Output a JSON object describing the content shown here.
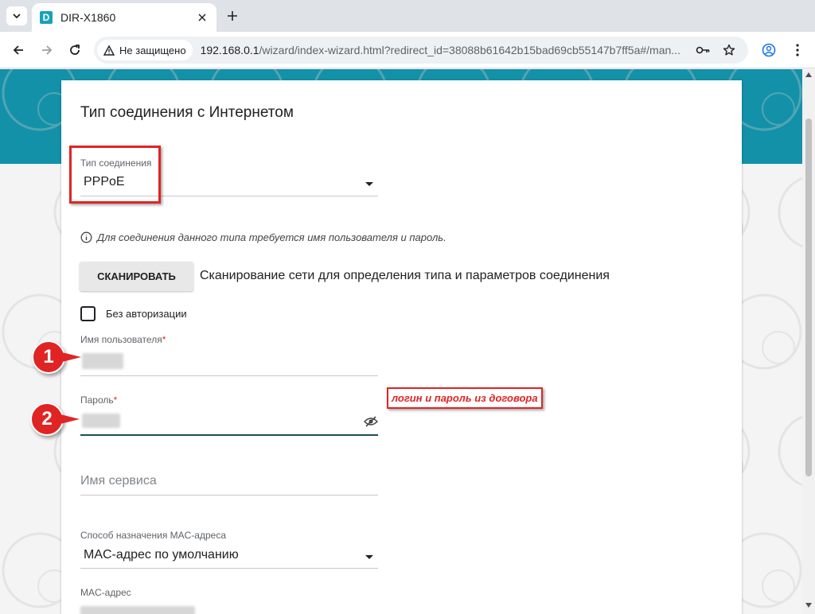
{
  "browser": {
    "tab_title": "DIR-X1860",
    "favicon_letter": "D",
    "security_label": "Не защищено",
    "url_host": "192.168.0.1",
    "url_path": "/wizard/index-wizard.html?redirect_id=38088b61642b15bad69cb55147b7ff5a#/man..."
  },
  "form": {
    "title": "Тип соединения с Интернетом",
    "connection_type": {
      "label": "Тип соединения",
      "value": "PPPoE"
    },
    "hint": "Для соединения данного типа требуется имя пользователя и пароль.",
    "scan_button": "СКАНИРОВАТЬ",
    "scan_description": "Сканирование сети для определения типа и параметров соединения",
    "no_auth_label": "Без авторизации",
    "no_auth_checked": false,
    "username": {
      "label": "Имя пользователя",
      "required_mark": "*"
    },
    "password": {
      "label": "Пароль",
      "required_mark": "*"
    },
    "service_name": {
      "placeholder": "Имя сервиса"
    },
    "mac_method": {
      "label": "Способ назначения MAC-адреса",
      "value": "MAC-адрес по умолчанию"
    },
    "mac_address": {
      "label": "MAC-адрес"
    }
  },
  "annotations": {
    "marker_1": "1",
    "marker_2": "2",
    "note": "логин и пароль из договора"
  },
  "colors": {
    "teal_band": "#1391a9",
    "highlight_red": "#e02424",
    "active_underline": "#1b4d5c"
  }
}
